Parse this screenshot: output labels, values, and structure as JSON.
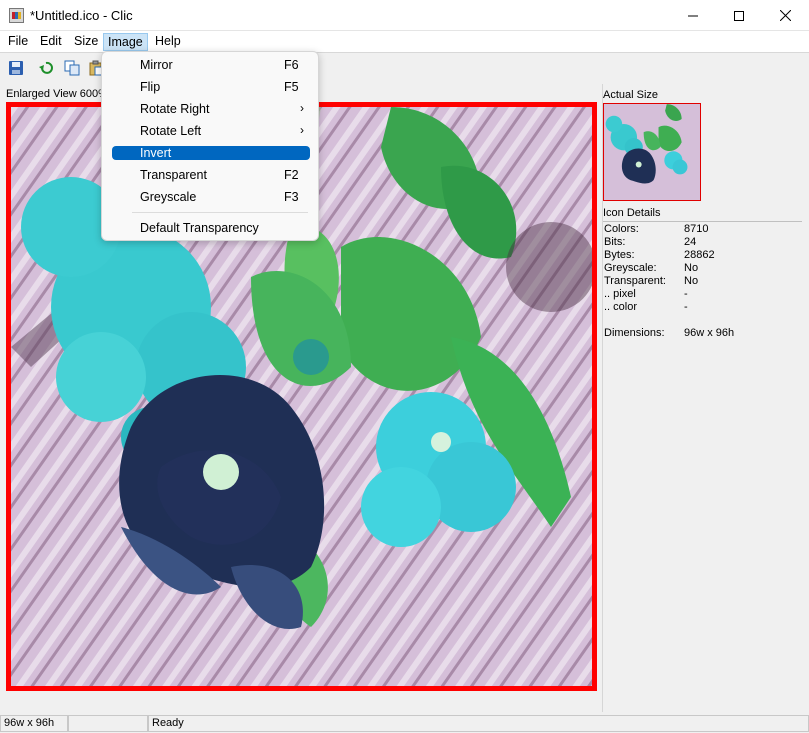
{
  "window": {
    "title": "*Untitled.ico - Clic"
  },
  "menubar": {
    "items": [
      "File",
      "Edit",
      "Size",
      "Image",
      "Help"
    ]
  },
  "toolbar": {
    "buttons": [
      "save-icon",
      "undo-icon",
      "copy-icon",
      "paste-icon"
    ]
  },
  "image_menu": {
    "items": [
      {
        "label": "Mirror",
        "shortcut": "F6"
      },
      {
        "label": "Flip",
        "shortcut": "F5"
      },
      {
        "label": "Rotate Right",
        "submenu": "›"
      },
      {
        "label": "Rotate Left",
        "submenu": "›"
      },
      {
        "label": "Invert",
        "highlighted": true
      },
      {
        "label": "Transparent",
        "shortcut": "F2"
      },
      {
        "label": "Greyscale",
        "shortcut": "F3"
      },
      {
        "label": "Default Transparency"
      }
    ]
  },
  "enlarged": {
    "label": "Enlarged View 600%"
  },
  "actual": {
    "label": "Actual Size"
  },
  "details": {
    "label": "Icon Details",
    "rows": [
      {
        "key": "Colors:",
        "value": "8710"
      },
      {
        "key": "Bits:",
        "value": "24"
      },
      {
        "key": "Bytes:",
        "value": "28862"
      },
      {
        "key": "Greyscale:",
        "value": "No"
      },
      {
        "key": "Transparent:",
        "value": "No"
      },
      {
        "key": ".. pixel",
        "value": "-"
      },
      {
        "key": ".. color",
        "value": "-"
      },
      {
        "key": "",
        "value": ""
      },
      {
        "key": "Dimensions:",
        "value": "96w x 96h"
      }
    ]
  },
  "status": {
    "size": "96w x 96h",
    "middle": "",
    "message": "Ready"
  },
  "colors": {
    "highlight": "#0067c0",
    "border_red": "#ff0000"
  }
}
